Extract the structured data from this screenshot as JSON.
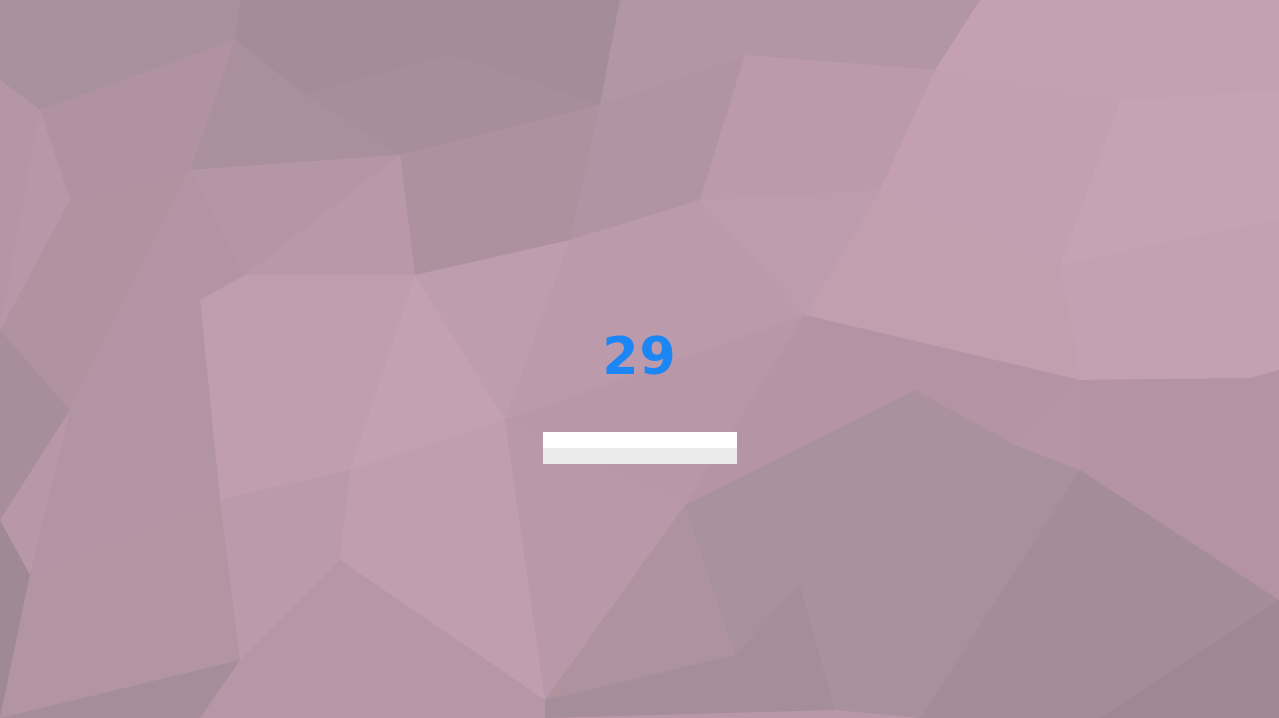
{
  "counter": {
    "value": "29",
    "color": "#1b86f4"
  },
  "progress": {
    "fraction": 0,
    "track_color": "#ebebeb",
    "highlight_color": "#ffffff"
  },
  "background": {
    "base_color": "#b898a8",
    "style": "low-poly-triangles"
  }
}
